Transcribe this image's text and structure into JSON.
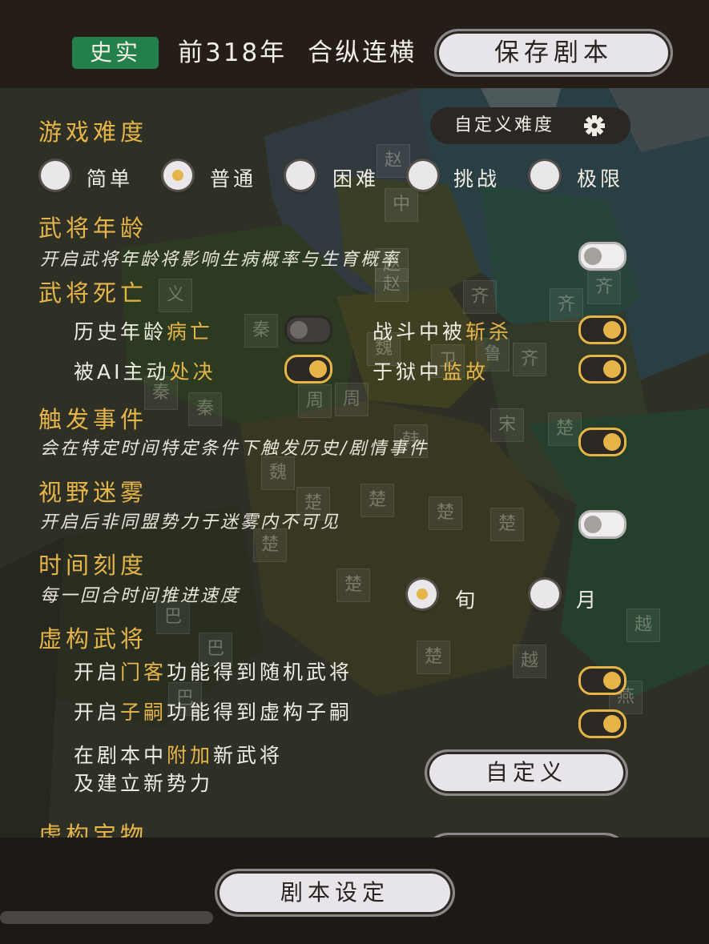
{
  "header": {
    "badge": "史实",
    "year": "前318年",
    "scenario_name": "合纵连横",
    "save_label": "保存剧本"
  },
  "difficulty": {
    "title": "游戏难度",
    "custom_label": "自定义难度",
    "options": [
      "简单",
      "普通",
      "困难",
      "挑战",
      "极限"
    ],
    "selected": "普通"
  },
  "general_age": {
    "title": "武将年龄",
    "desc": "开启武将年龄将影响生病概率与生育概率",
    "enabled": false
  },
  "general_death": {
    "title": "武将死亡",
    "items": [
      {
        "text": "历史年龄",
        "hl": "病亡",
        "enabled": false
      },
      {
        "text": "战斗中被",
        "hl": "斩杀",
        "enabled": true
      },
      {
        "text": "被AI主动",
        "hl": "处决",
        "enabled": true
      },
      {
        "text": "于狱中",
        "hl": "监故",
        "enabled": true
      }
    ]
  },
  "events": {
    "title": "触发事件",
    "desc": "会在特定时间特定条件下触发历史/剧情事件",
    "enabled": true
  },
  "fog": {
    "title": "视野迷雾",
    "desc": "开启后非同盟势力于迷雾内不可见",
    "enabled": false
  },
  "time_scale": {
    "title": "时间刻度",
    "desc": "每一回合时间推进速度",
    "options": [
      "旬",
      "月"
    ],
    "selected": "旬"
  },
  "fictional_generals": {
    "title": "虚构武将",
    "menke": {
      "pre": "开启",
      "hl": "门客",
      "post": "功能得到随机武将",
      "enabled": true
    },
    "zisi": {
      "pre": "开启",
      "hl": "子嗣",
      "post": "功能得到虚构子嗣",
      "enabled": true
    },
    "addon": {
      "pre": "在剧本中",
      "hl": "附加",
      "post": "新武将",
      "line2": "及建立新势力"
    },
    "custom_label": "自定义"
  },
  "fictional_treasures": {
    "title": "虚构宝物"
  },
  "footer": {
    "settings_label": "剧本设定"
  },
  "map_labels": [
    "赵",
    "赵",
    "赵",
    "中",
    "齐",
    "齐",
    "齐",
    "义",
    "秦",
    "魏",
    "卫",
    "鲁",
    "齐",
    "秦",
    "秦",
    "周",
    "周",
    "韩",
    "宋",
    "楚",
    "魏",
    "楚",
    "楚",
    "楚",
    "楚",
    "楚",
    "巴",
    "巴",
    "巴",
    "楚",
    "越",
    "越",
    "楚",
    "燕"
  ]
}
